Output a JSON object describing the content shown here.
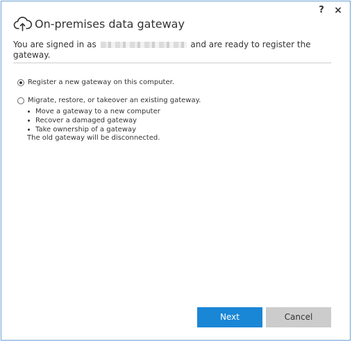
{
  "window": {
    "help_label": "?",
    "close_label": "×"
  },
  "header": {
    "icon": "cloud-upload-icon",
    "title": "On-premises data gateway"
  },
  "intro": {
    "prefix": "You are signed in as",
    "suffix": "and are ready to register the gateway."
  },
  "options": [
    {
      "label": "Register a new gateway on this computer.",
      "selected": true
    },
    {
      "label": "Migrate, restore, or takeover an existing gateway.",
      "selected": false
    }
  ],
  "migrate_bullets": [
    "Move a gateway to a new computer",
    "Recover a damaged gateway",
    "Take ownership of a gateway"
  ],
  "note": "The old gateway will be disconnected.",
  "buttons": {
    "next": "Next",
    "cancel": "Cancel"
  },
  "colors": {
    "primary": "#1a86d6",
    "secondary": "#cccccc",
    "border": "#6b9fd3"
  }
}
